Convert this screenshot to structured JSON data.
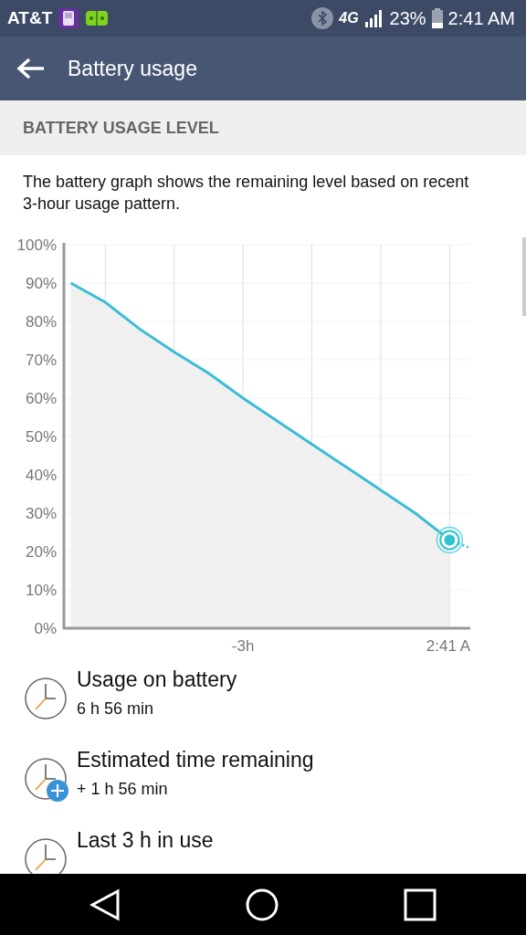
{
  "status_bar": {
    "carrier": "AT&T",
    "network": "4G",
    "battery": "23%",
    "time": "2:41 AM"
  },
  "app_bar": {
    "title": "Battery usage"
  },
  "section": {
    "header": "BATTERY USAGE LEVEL",
    "description": "The battery graph shows the remaining level based on recent 3-hour usage pattern."
  },
  "chart_data": {
    "type": "area",
    "categories": [
      null,
      null,
      null,
      null,
      null,
      "-3h",
      null,
      null,
      null,
      null,
      null,
      "2:41 A"
    ],
    "series": [
      {
        "color": "#3bbcd6",
        "values": [
          90,
          85,
          78,
          72,
          66.5,
          60,
          54,
          48,
          42,
          36,
          30,
          23
        ]
      }
    ],
    "ylim": [
      0,
      100
    ],
    "grid": true,
    "yticks": [
      {
        "value": 0,
        "label": "0%"
      },
      {
        "value": 10,
        "label": "10%"
      },
      {
        "value": 20,
        "label": "20%"
      },
      {
        "value": 30,
        "label": "30%"
      },
      {
        "value": 40,
        "label": "40%"
      },
      {
        "value": 50,
        "label": "50%"
      },
      {
        "value": 60,
        "label": "60%"
      },
      {
        "value": 70,
        "label": "70%"
      },
      {
        "value": 80,
        "label": "80%"
      },
      {
        "value": 90,
        "label": "90%"
      },
      {
        "value": 100,
        "label": "100%"
      }
    ]
  },
  "items": [
    {
      "title": "Usage on battery",
      "value": "6 h 56 min",
      "kind": "usage"
    },
    {
      "title": "Estimated time remaining",
      "value": "+ 1 h 56 min",
      "kind": "estimate"
    },
    {
      "title": "Last 3 h in use",
      "kind": "usage"
    }
  ]
}
